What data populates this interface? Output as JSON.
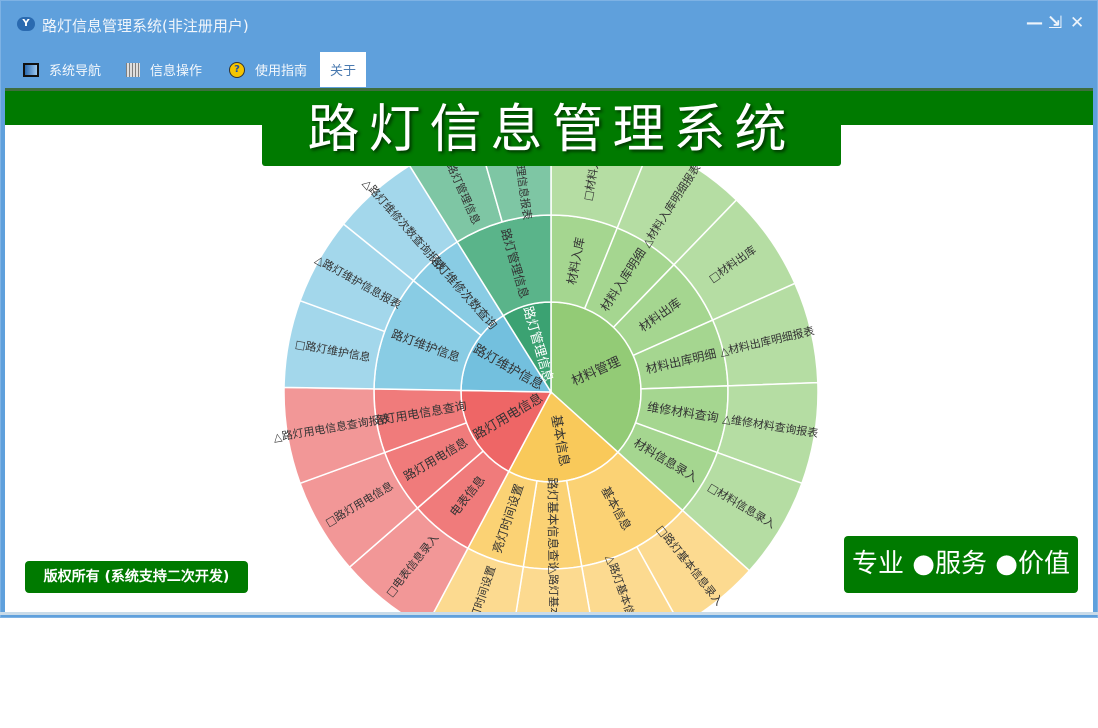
{
  "window": {
    "title": "路灯信息管理系统(非注册用户)",
    "app_icon": "app-logo-icon",
    "controls": {
      "minimize": "—",
      "restore": "⇲",
      "close": "✕"
    }
  },
  "menu": [
    {
      "label": "系统导航",
      "icon": "window-icon"
    },
    {
      "label": "信息操作",
      "icon": "grid-icon"
    },
    {
      "label": "使用指南",
      "icon": "help-icon"
    },
    {
      "label": "关于",
      "icon": null,
      "active": true
    }
  ],
  "banner": {
    "title": "路灯信息管理系统"
  },
  "badges": {
    "slogan": "专业 ●服务 ●价值",
    "copyright": "版权所有 (系统支持二次开发)"
  },
  "colors": {
    "green_bar": "#007a00",
    "window_blue": "#5fa0dc"
  },
  "chart_data": {
    "type": "sunburst",
    "series": [
      {
        "name": "材料管理",
        "colors": [
          "#93cb76",
          "#a5d690",
          "#b5dda3"
        ],
        "children": [
          {
            "name": "材料入库",
            "children": [
              {
                "name": "□材料入库",
                "value": 22
              }
            ]
          },
          {
            "name": "材料入库明细",
            "children": [
              {
                "name": "△材料入库明细报表",
                "value": 22
              }
            ]
          },
          {
            "name": "材料出库",
            "children": [
              {
                "name": "□材料出库",
                "value": 22
              }
            ]
          },
          {
            "name": "材料出库明细",
            "children": [
              {
                "name": "△材料出库明细报表",
                "value": 22
              }
            ]
          },
          {
            "name": "维修材料查询",
            "children": [
              {
                "name": "△维修材料查询报表",
                "value": 22
              }
            ]
          },
          {
            "name": "材料信息录入",
            "children": [
              {
                "name": "□材料信息录入",
                "value": 22
              }
            ]
          }
        ]
      },
      {
        "name": "基本信息",
        "colors": [
          "#f9c95a",
          "#fbd274",
          "#fcda90"
        ],
        "children": [
          {
            "name": "基本信息",
            "children": [
              {
                "name": "□路灯基本信息录入",
                "value": 19
              },
              {
                "name": "△路灯基本信息报表",
                "value": 19
              }
            ]
          },
          {
            "name": "路灯基本信息查询",
            "children": [
              {
                "name": "△路灯基本信息查询",
                "value": 19
              }
            ]
          },
          {
            "name": "亮灯时间设置",
            "children": [
              {
                "name": "□亮灯时间设置",
                "value": 19
              }
            ]
          }
        ]
      },
      {
        "name": "路灯用电信息",
        "colors": [
          "#ee6666",
          "#f07b7b",
          "#f29797"
        ],
        "children": [
          {
            "name": "电表信息",
            "children": [
              {
                "name": "□电表信息录入",
                "value": 21
              }
            ]
          },
          {
            "name": "路灯用电信息",
            "children": [
              {
                "name": "□路灯用电信息",
                "value": 21
              }
            ]
          },
          {
            "name": "路灯用电信息查询",
            "children": [
              {
                "name": "△路灯用电信息查询报表",
                "value": 21
              }
            ]
          }
        ]
      },
      {
        "name": "路灯维护信息",
        "colors": [
          "#73c0de",
          "#89cce4",
          "#a3d7eb"
        ],
        "children": [
          {
            "name": "路灯维护信息",
            "children": [
              {
                "name": "□路灯维护信息",
                "value": 19
              },
              {
                "name": "△路灯维护信息报表",
                "value": 19
              }
            ]
          },
          {
            "name": "路灯维修次数查询",
            "children": [
              {
                "name": "△路灯维修次数查询报表",
                "value": 19
              }
            ]
          }
        ]
      },
      {
        "name": "路灯管理信息",
        "colors": [
          "#3ba272",
          "#5ab48a",
          "#7ec6a4"
        ],
        "children": [
          {
            "name": "路灯管理信息",
            "children": [
              {
                "name": "□路灯管理信息",
                "value": 16
              },
              {
                "name": "△路灯管理信息报表",
                "value": 16
              }
            ]
          }
        ]
      }
    ]
  }
}
